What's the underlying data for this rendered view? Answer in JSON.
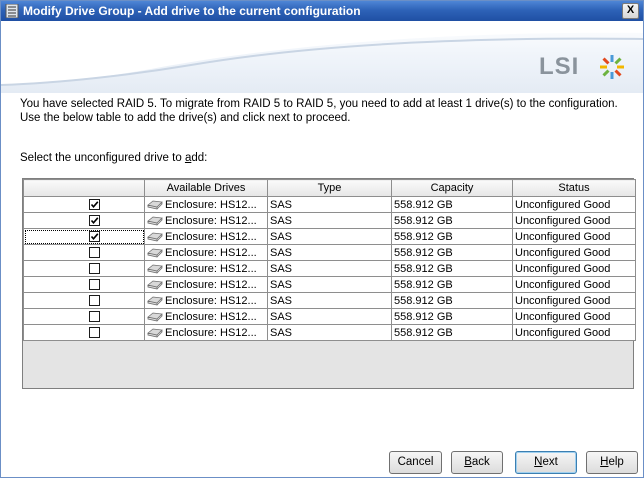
{
  "window": {
    "title": "Modify Drive Group - Add drive to the current configuration",
    "close_label": "X"
  },
  "banner": {
    "logo_text": "LSI"
  },
  "content": {
    "intro_line1": "You have selected RAID 5. To migrate from RAID 5 to RAID 5, you need to add at least 1 drive(s) to the configuration.",
    "intro_line2": "Use the below table to add the drive(s) and click next to proceed.",
    "select_label_pre": "Select the unconfigured drive to ",
    "select_label_acc": "a",
    "select_label_post": "dd:"
  },
  "table": {
    "columns": [
      "",
      "Available Drives",
      "Type",
      "Capacity",
      "Status"
    ],
    "rows": [
      {
        "checked": true,
        "drive": "Enclosure: HS12...",
        "type": "SAS",
        "capacity": "558.912 GB",
        "status": "Unconfigured Good"
      },
      {
        "checked": true,
        "drive": "Enclosure: HS12...",
        "type": "SAS",
        "capacity": "558.912 GB",
        "status": "Unconfigured Good"
      },
      {
        "checked": true,
        "drive": "Enclosure: HS12...",
        "type": "SAS",
        "capacity": "558.912 GB",
        "status": "Unconfigured Good"
      },
      {
        "checked": false,
        "drive": "Enclosure: HS12...",
        "type": "SAS",
        "capacity": "558.912 GB",
        "status": "Unconfigured Good"
      },
      {
        "checked": false,
        "drive": "Enclosure: HS12...",
        "type": "SAS",
        "capacity": "558.912 GB",
        "status": "Unconfigured Good"
      },
      {
        "checked": false,
        "drive": "Enclosure: HS12...",
        "type": "SAS",
        "capacity": "558.912 GB",
        "status": "Unconfigured Good"
      },
      {
        "checked": false,
        "drive": "Enclosure: HS12...",
        "type": "SAS",
        "capacity": "558.912 GB",
        "status": "Unconfigured Good"
      },
      {
        "checked": false,
        "drive": "Enclosure: HS12...",
        "type": "SAS",
        "capacity": "558.912 GB",
        "status": "Unconfigured Good"
      },
      {
        "checked": false,
        "drive": "Enclosure: HS12...",
        "type": "SAS",
        "capacity": "558.912 GB",
        "status": "Unconfigured Good"
      }
    ]
  },
  "buttons": {
    "cancel": {
      "label": "Cancel"
    },
    "back": {
      "acc": "B",
      "rest": "ack"
    },
    "next": {
      "acc": "N",
      "rest": "ext"
    },
    "help": {
      "acc": "H",
      "rest": "elp"
    }
  },
  "colors": {
    "title_bar": "#2e63b8",
    "banner_swoosh": "#ffffff",
    "logo": "#8a939c"
  },
  "icons": {
    "app": "drive-group-icon",
    "drive": "hard-drive-icon",
    "logo_mark": "lsi-starburst-icon"
  }
}
